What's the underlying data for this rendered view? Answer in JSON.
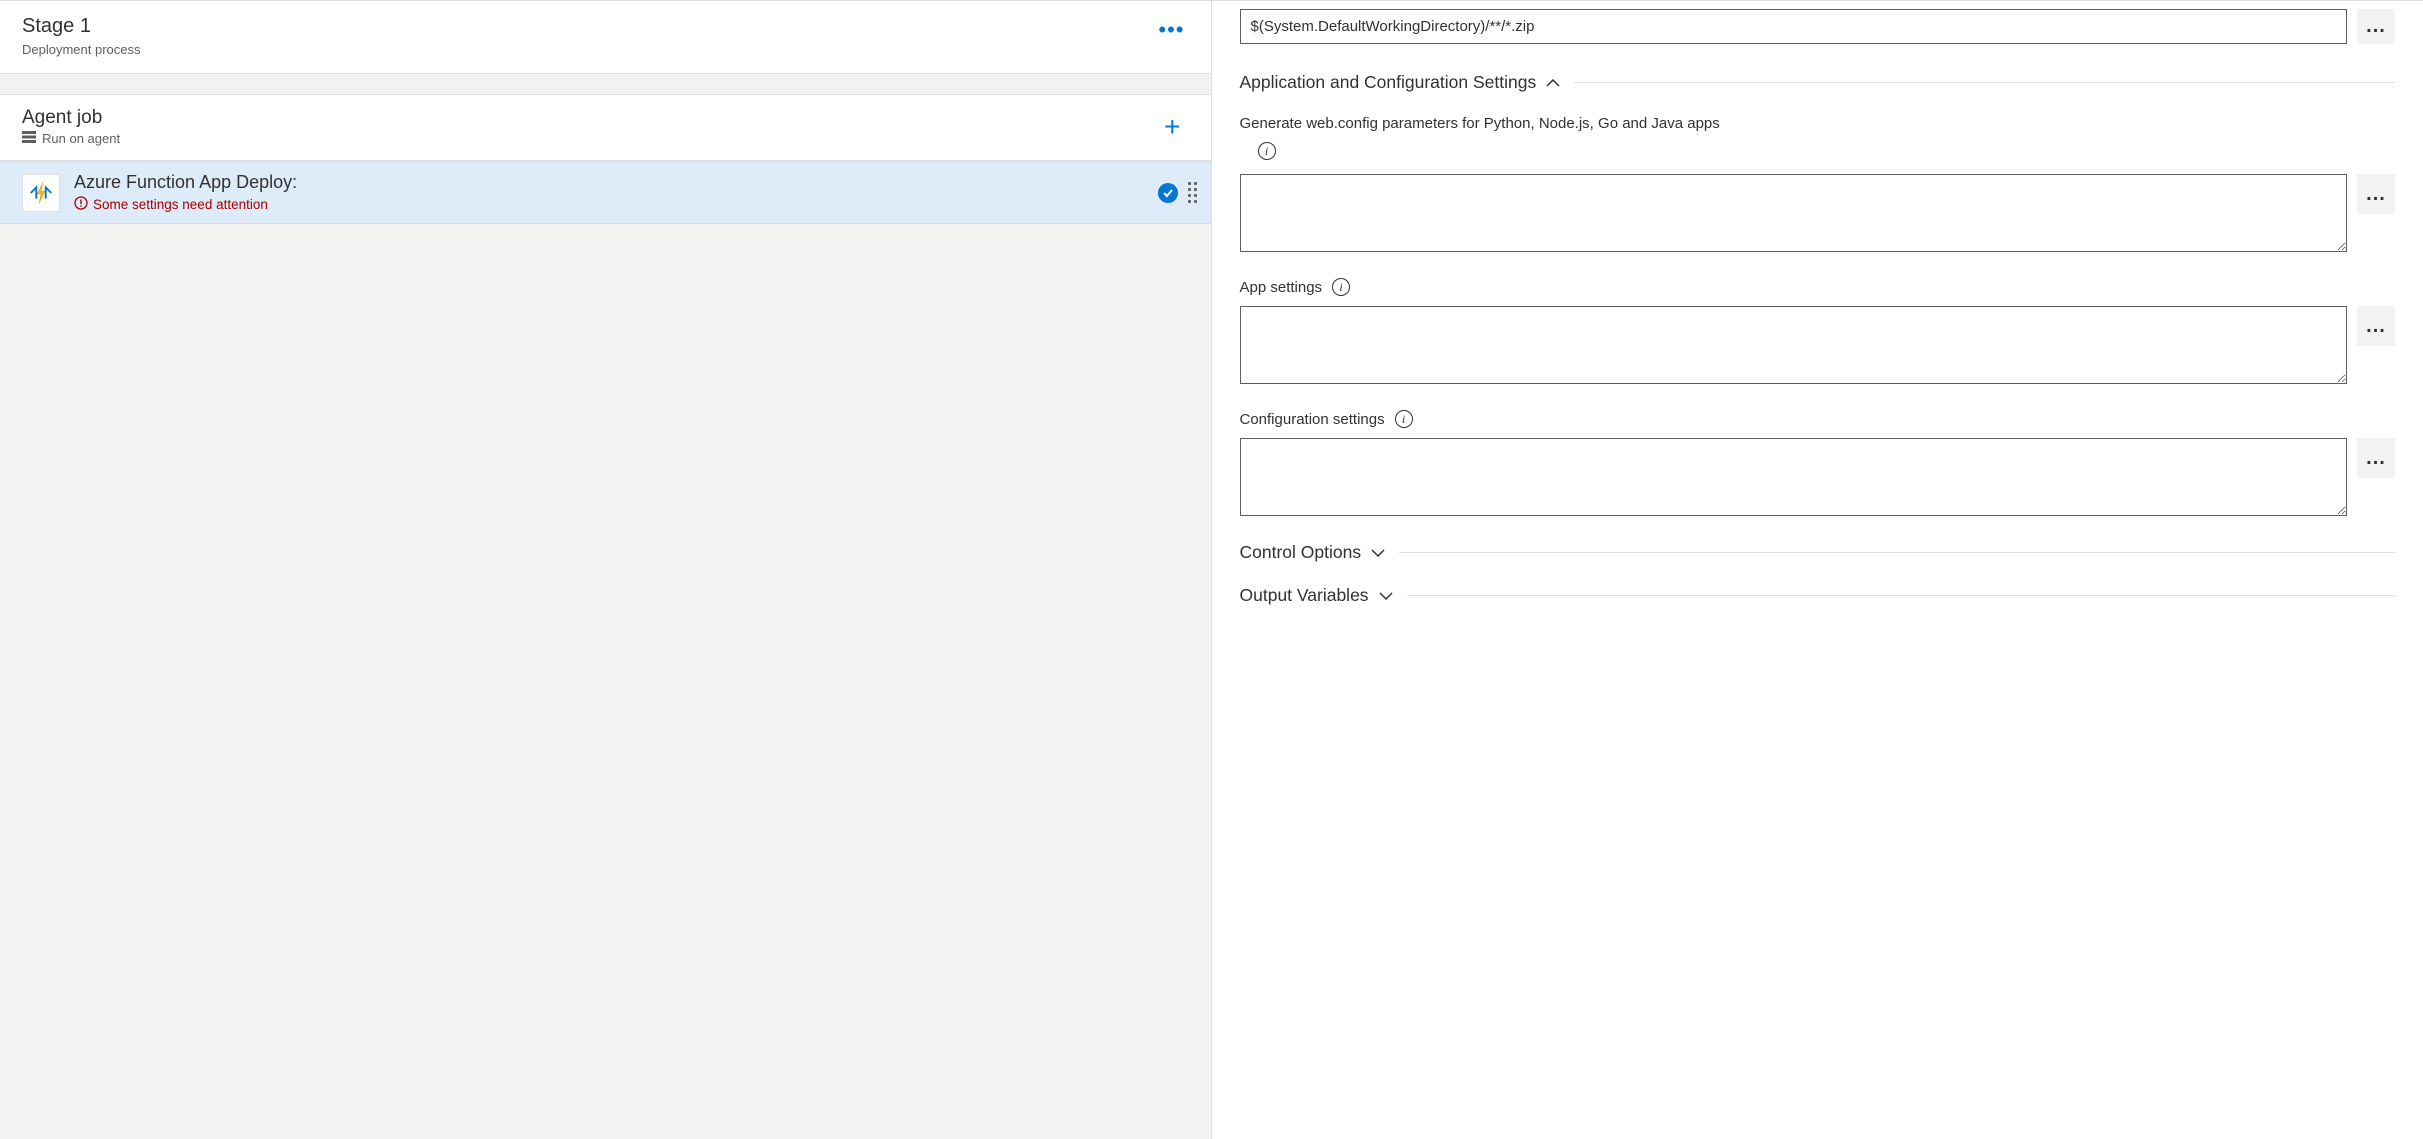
{
  "left": {
    "stage": {
      "title": "Stage 1",
      "subtitle": "Deployment process"
    },
    "agent": {
      "title": "Agent job",
      "subtitle": "Run on agent"
    },
    "task": {
      "title": "Azure Function App Deploy:",
      "warning": "Some settings need attention"
    }
  },
  "right": {
    "package_field": {
      "value": "$(System.DefaultWorkingDirectory)/**/*.zip"
    },
    "sections": {
      "app_config": {
        "title": "Application and Configuration Settings",
        "expanded": true,
        "fields": {
          "webconfig": {
            "label": "Generate web.config parameters for Python, Node.js, Go and Java apps",
            "value": ""
          },
          "app_settings": {
            "label": "App settings",
            "value": ""
          },
          "config_settings": {
            "label": "Configuration settings",
            "value": ""
          }
        }
      },
      "control_options": {
        "title": "Control Options",
        "expanded": false
      },
      "output_vars": {
        "title": "Output Variables",
        "expanded": false
      }
    }
  }
}
